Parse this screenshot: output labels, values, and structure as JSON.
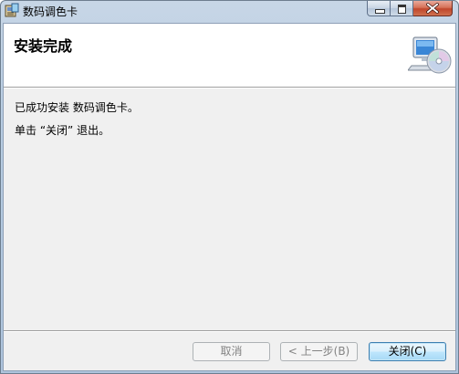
{
  "window": {
    "title": "数码调色卡",
    "icon": "installer-package-icon"
  },
  "header": {
    "title": "安装完成",
    "icon": "computer-cd-icon"
  },
  "messages": [
    "已成功安装 数码调色卡。",
    "单击 “关闭” 退出。"
  ],
  "buttons": {
    "cancel": "取消",
    "back": "< 上一步(B)",
    "close": "关闭(C)"
  },
  "colors": {
    "title_bar": "#b9cde2",
    "client_bg": "#f0f0f0",
    "close_button": "#c0462c"
  }
}
